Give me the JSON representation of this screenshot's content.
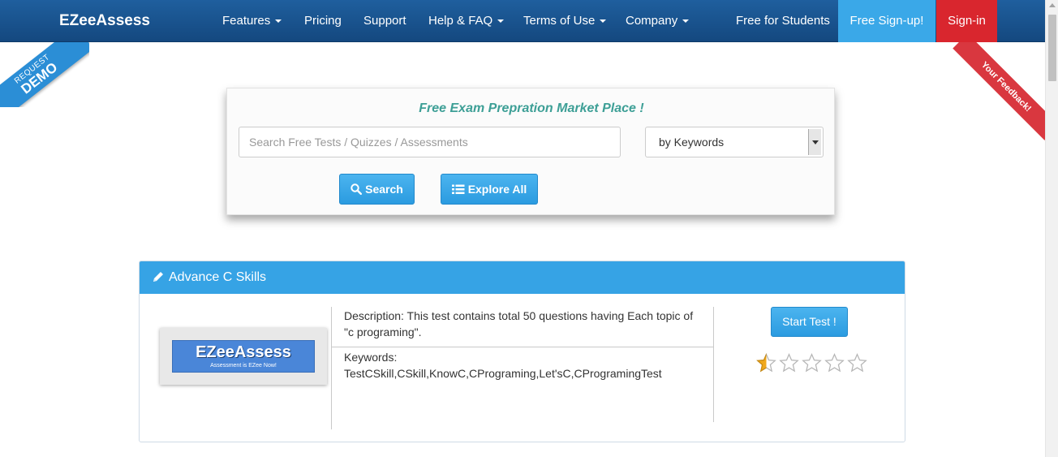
{
  "navbar": {
    "brand": "EZeeAssess",
    "items": [
      {
        "label": "Features",
        "dropdown": true
      },
      {
        "label": "Pricing",
        "dropdown": false
      },
      {
        "label": "Support",
        "dropdown": false
      },
      {
        "label": "Help & FAQ",
        "dropdown": true
      },
      {
        "label": "Terms of Use",
        "dropdown": true
      },
      {
        "label": "Company",
        "dropdown": true
      },
      {
        "label": "Free for Students",
        "dropdown": false
      }
    ],
    "signup_label": "Free Sign-up!",
    "signin_label": "Sign-in"
  },
  "ribbons": {
    "demo_small": "REQUEST",
    "demo_big": "DEMO",
    "feedback": "Your Feedback!"
  },
  "search": {
    "title": "Free Exam Prepration Market Place !",
    "placeholder": "Search Free Tests / Quizzes / Assessments",
    "select_value": "by Keywords",
    "search_label": "Search",
    "explore_label": "Explore All"
  },
  "test_card": {
    "title": "Advance C Skills",
    "logo_text": "EZeeAssess",
    "logo_tagline": "Assessment is EZee Now!",
    "description": "Description: This test contains total 50 questions having Each topic of \"c programing\".",
    "keywords_label": "Keywords:",
    "keywords": "TestCSkill,CSkill,KnowC,CPrograming,Let'sC,CProgramingTest",
    "start_label": "Start Test !",
    "rating": 0.5,
    "rating_max": 5
  },
  "colors": {
    "navbar": "#1a5590",
    "accent_blue": "#36a3e5",
    "signin_red": "#d9262e",
    "title_teal": "#3d9f96",
    "star_gold": "#f0a81c"
  }
}
